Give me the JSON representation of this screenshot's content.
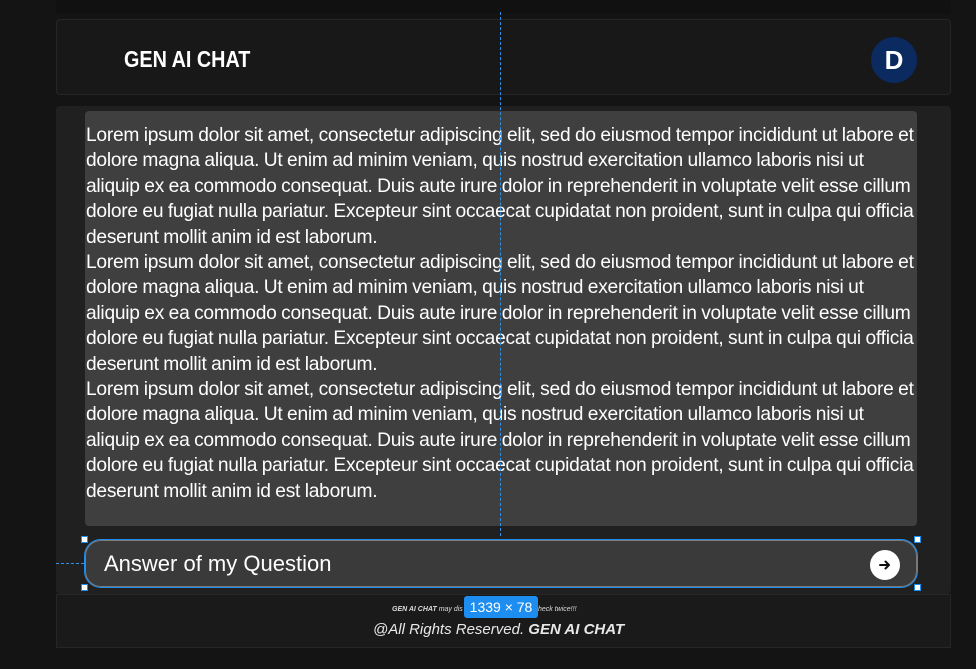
{
  "header": {
    "title": "GEN AI CHAT",
    "avatar_initial": "D"
  },
  "message": {
    "paragraphs": [
      "Lorem ipsum dolor sit amet, consectetur adipiscing elit, sed do eiusmod tempor incididunt ut labore et dolore magna aliqua. Ut enim ad minim veniam, quis nostrud exercitation ullamco laboris nisi ut aliquip ex ea commodo consequat. Duis aute irure dolor in reprehenderit in voluptate velit esse cillum dolore eu fugiat nulla pariatur. Excepteur sint occaecat cupidatat non proident, sunt in culpa qui officia deserunt mollit anim id est laborum.",
      "Lorem ipsum dolor sit amet, consectetur adipiscing elit, sed do eiusmod tempor incididunt ut labore et dolore magna aliqua. Ut enim ad minim veniam, quis nostrud exercitation ullamco laboris nisi ut aliquip ex ea commodo consequat. Duis aute irure dolor in reprehenderit in voluptate velit esse cillum dolore eu fugiat nulla pariatur. Excepteur sint occaecat cupidatat non proident, sunt in culpa qui officia deserunt mollit anim id est laborum.",
      "Lorem ipsum dolor sit amet, consectetur adipiscing elit, sed do eiusmod tempor incididunt ut labore et dolore magna aliqua. Ut enim ad minim veniam, quis nostrud exercitation ullamco laboris nisi ut aliquip ex ea commodo consequat. Duis aute irure dolor in reprehenderit in voluptate velit esse cillum dolore eu fugiat nulla pariatur. Excepteur sint occaecat cupidatat non proident, sunt in culpa qui officia deserunt mollit anim id est laborum."
    ]
  },
  "input": {
    "value": "Answer of my Question",
    "send_icon": "arrow-right-circle-icon"
  },
  "overlay": {
    "dimension_label": "1339 × 78"
  },
  "footer": {
    "disclaimer_brand": "GEN AI CHAT",
    "disclaimer_start": "may dis",
    "disclaimer_end": "heck twice!!!",
    "copyright_prefix": "@All Rights Reserved.",
    "copyright_brand": "GEN AI CHAT"
  },
  "colors": {
    "accent": "#1d8ef0",
    "avatar_bg": "#0b2a5f",
    "message_bg": "#3f3f3f"
  }
}
